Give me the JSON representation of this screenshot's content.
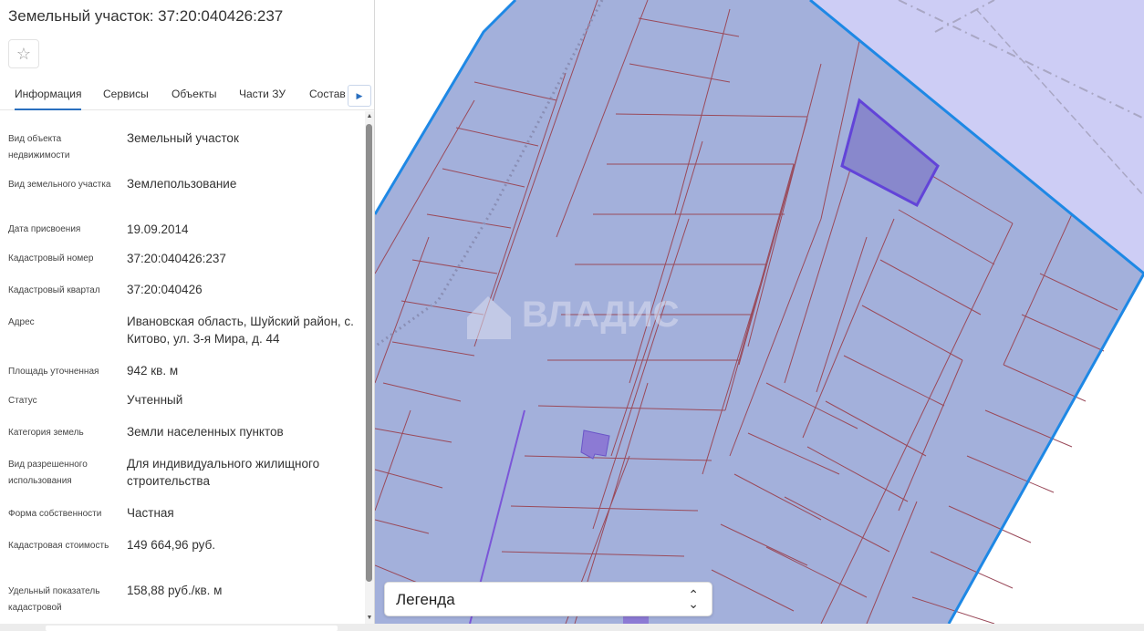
{
  "panel": {
    "title": "Земельный участок: 37:20:040426:237",
    "tabs": [
      {
        "label": "Информация"
      },
      {
        "label": "Сервисы"
      },
      {
        "label": "Объекты"
      },
      {
        "label": "Части ЗУ"
      },
      {
        "label": "Состав"
      }
    ],
    "rows": [
      {
        "key": "Вид объекта недвижимости",
        "value": "Земельный участок"
      },
      {
        "key": "Вид земельного участка",
        "value": "Землепользование"
      },
      {
        "key": "Дата присвоения",
        "value": "19.09.2014"
      },
      {
        "key": "Кадастровый номер",
        "value": "37:20:040426:237"
      },
      {
        "key": "Кадастровый квартал",
        "value": "37:20:040426"
      },
      {
        "key": "Адрес",
        "value": "Ивановская область, Шуйский район, с. Китово, ул. 3-я Мира, д. 44"
      },
      {
        "key": "Площадь уточненная",
        "value": "942 кв. м"
      },
      {
        "key": "Статус",
        "value": "Учтенный"
      },
      {
        "key": "Категория земель",
        "value": "Земли населенных пунктов"
      },
      {
        "key": "Вид разрешенного использования",
        "value": "Для индивидуального жилищного строительства"
      },
      {
        "key": "Форма собственности",
        "value": "Частная"
      },
      {
        "key": "Кадастровая стоимость",
        "value": "149 664,96 руб."
      },
      {
        "key": "Удельный показатель кадастровой",
        "value": "158,88 руб./кв. м"
      }
    ]
  },
  "map": {
    "watermark": "ВЛАДИС",
    "legend_label": "Легенда",
    "colors": {
      "parcel_fill": "#a3b0db",
      "light_area": "#cdcdf5",
      "boundary": "#1e88e5",
      "parcel_lines": "#9a4a5a",
      "highlight": "#7b6ad0"
    }
  }
}
